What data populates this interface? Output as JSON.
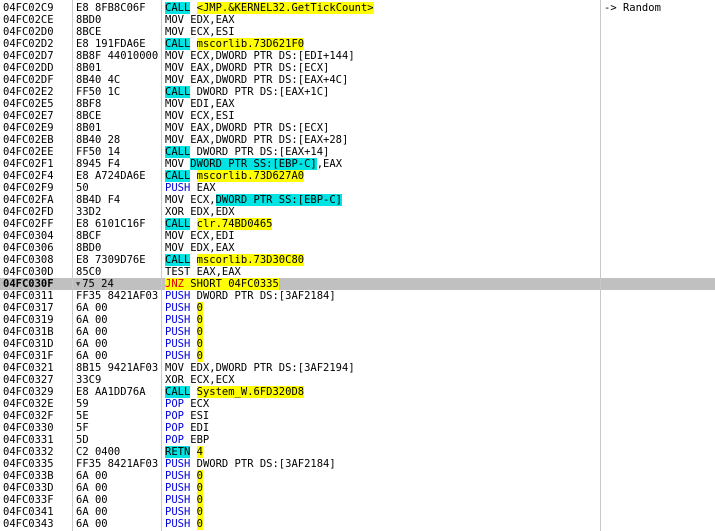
{
  "meta": {
    "view": "cpu-disassembly",
    "selected_address": "04FC030F"
  },
  "colors": {
    "background": "#ffffff",
    "text": "#000000",
    "highlight_call_bg": "#00e4e4",
    "highlight_operand_bg": "#ffff00",
    "jump_mnemonic_text": "#e00000",
    "stack_op_text": "#0000de",
    "selected_row_bg": "#c0c0c0",
    "grid_line": "#c8c8c8"
  },
  "icons": {
    "jump_down": "▼"
  },
  "rows": [
    {
      "a": "04FC02C9",
      "b": "E8 8FB8C06F",
      "d": [
        {
          "t": "CALL",
          "s": "c"
        },
        {
          "t": " ",
          "s": "p"
        },
        {
          "t": "<JMP.&KERNEL32.GetTickCount>",
          "s": "y"
        }
      ],
      "cm": "-> Random"
    },
    {
      "a": "04FC02CE",
      "b": "8BD0",
      "d": [
        {
          "t": "MOV EDX,EAX",
          "s": "p"
        }
      ]
    },
    {
      "a": "04FC02D0",
      "b": "8BCE",
      "d": [
        {
          "t": "MOV ECX,ESI",
          "s": "p"
        }
      ]
    },
    {
      "a": "04FC02D2",
      "b": "E8 191FDA6E",
      "d": [
        {
          "t": "CALL",
          "s": "c"
        },
        {
          "t": " ",
          "s": "p"
        },
        {
          "t": "mscorlib.73D621F0",
          "s": "y"
        }
      ]
    },
    {
      "a": "04FC02D7",
      "b": "8B8F 44010000",
      "d": [
        {
          "t": "MOV ECX,DWORD PTR DS:[EDI+144]",
          "s": "p"
        }
      ]
    },
    {
      "a": "04FC02DD",
      "b": "8B01",
      "d": [
        {
          "t": "MOV EAX,DWORD PTR DS:[ECX]",
          "s": "p"
        }
      ]
    },
    {
      "a": "04FC02DF",
      "b": "8B40 4C",
      "d": [
        {
          "t": "MOV EAX,DWORD PTR DS:[EAX+4C]",
          "s": "p"
        }
      ]
    },
    {
      "a": "04FC02E2",
      "b": "FF50 1C",
      "d": [
        {
          "t": "CALL",
          "s": "c"
        },
        {
          "t": " DWORD PTR DS:[EAX+1C]",
          "s": "p"
        }
      ]
    },
    {
      "a": "04FC02E5",
      "b": "8BF8",
      "d": [
        {
          "t": "MOV EDI,EAX",
          "s": "p"
        }
      ]
    },
    {
      "a": "04FC02E7",
      "b": "8BCE",
      "d": [
        {
          "t": "MOV ECX,ESI",
          "s": "p"
        }
      ]
    },
    {
      "a": "04FC02E9",
      "b": "8B01",
      "d": [
        {
          "t": "MOV EAX,DWORD PTR DS:[ECX]",
          "s": "p"
        }
      ]
    },
    {
      "a": "04FC02EB",
      "b": "8B40 28",
      "d": [
        {
          "t": "MOV EAX,DWORD PTR DS:[EAX+28]",
          "s": "p"
        }
      ]
    },
    {
      "a": "04FC02EE",
      "b": "FF50 14",
      "d": [
        {
          "t": "CALL",
          "s": "c"
        },
        {
          "t": " DWORD PTR DS:[EAX+14]",
          "s": "p"
        }
      ]
    },
    {
      "a": "04FC02F1",
      "b": "8945 F4",
      "d": [
        {
          "t": "MOV ",
          "s": "p"
        },
        {
          "t": "DWORD PTR SS:[EBP-C]",
          "s": "c"
        },
        {
          "t": ",EAX",
          "s": "p"
        }
      ]
    },
    {
      "a": "04FC02F4",
      "b": "E8 A724DA6E",
      "d": [
        {
          "t": "CALL",
          "s": "c"
        },
        {
          "t": " ",
          "s": "p"
        },
        {
          "t": "mscorlib.73D627A0",
          "s": "y"
        }
      ]
    },
    {
      "a": "04FC02F9",
      "b": "50",
      "d": [
        {
          "t": "PUSH",
          "s": "b"
        },
        {
          "t": " EAX",
          "s": "p"
        }
      ]
    },
    {
      "a": "04FC02FA",
      "b": "8B4D F4",
      "d": [
        {
          "t": "MOV ECX,",
          "s": "p"
        },
        {
          "t": "DWORD PTR SS:[EBP-C]",
          "s": "c"
        }
      ]
    },
    {
      "a": "04FC02FD",
      "b": "33D2",
      "d": [
        {
          "t": "XOR EDX,EDX",
          "s": "p"
        }
      ]
    },
    {
      "a": "04FC02FF",
      "b": "E8 6101C16F",
      "d": [
        {
          "t": "CALL",
          "s": "c"
        },
        {
          "t": " ",
          "s": "p"
        },
        {
          "t": "clr.74BD0465",
          "s": "y"
        }
      ]
    },
    {
      "a": "04FC0304",
      "b": "8BCF",
      "d": [
        {
          "t": "MOV ECX,EDI",
          "s": "p"
        }
      ]
    },
    {
      "a": "04FC0306",
      "b": "8BD0",
      "d": [
        {
          "t": "MOV EDX,EAX",
          "s": "p"
        }
      ]
    },
    {
      "a": "04FC0308",
      "b": "E8 7309D76E",
      "d": [
        {
          "t": "CALL",
          "s": "c"
        },
        {
          "t": " ",
          "s": "p"
        },
        {
          "t": "mscorlib.73D30C80",
          "s": "y"
        }
      ]
    },
    {
      "a": "04FC030D",
      "b": "85C0",
      "d": [
        {
          "t": "TEST EAX,EAX",
          "s": "p"
        }
      ]
    },
    {
      "a": "04FC030F",
      "b": "75 24",
      "sel": true,
      "mk": true,
      "d": [
        {
          "t": "JNZ",
          "s": "r"
        },
        {
          "t": " SHORT 04FC0335",
          "s": "y"
        }
      ]
    },
    {
      "a": "04FC0311",
      "b": "FF35 8421AF03",
      "d": [
        {
          "t": "PUSH",
          "s": "b"
        },
        {
          "t": " DWORD PTR DS:[3AF2184]",
          "s": "p"
        }
      ]
    },
    {
      "a": "04FC0317",
      "b": "6A 00",
      "d": [
        {
          "t": "PUSH",
          "s": "b"
        },
        {
          "t": " ",
          "s": "p"
        },
        {
          "t": "0",
          "s": "y"
        }
      ]
    },
    {
      "a": "04FC0319",
      "b": "6A 00",
      "d": [
        {
          "t": "PUSH",
          "s": "b"
        },
        {
          "t": " ",
          "s": "p"
        },
        {
          "t": "0",
          "s": "y"
        }
      ]
    },
    {
      "a": "04FC031B",
      "b": "6A 00",
      "d": [
        {
          "t": "PUSH",
          "s": "b"
        },
        {
          "t": " ",
          "s": "p"
        },
        {
          "t": "0",
          "s": "y"
        }
      ]
    },
    {
      "a": "04FC031D",
      "b": "6A 00",
      "d": [
        {
          "t": "PUSH",
          "s": "b"
        },
        {
          "t": " ",
          "s": "p"
        },
        {
          "t": "0",
          "s": "y"
        }
      ]
    },
    {
      "a": "04FC031F",
      "b": "6A 00",
      "d": [
        {
          "t": "PUSH",
          "s": "b"
        },
        {
          "t": " ",
          "s": "p"
        },
        {
          "t": "0",
          "s": "y"
        }
      ]
    },
    {
      "a": "04FC0321",
      "b": "8B15 9421AF03",
      "d": [
        {
          "t": "MOV EDX,DWORD PTR DS:[3AF2194]",
          "s": "p"
        }
      ]
    },
    {
      "a": "04FC0327",
      "b": "33C9",
      "d": [
        {
          "t": "XOR ECX,ECX",
          "s": "p"
        }
      ]
    },
    {
      "a": "04FC0329",
      "b": "E8 AA1DD76A",
      "d": [
        {
          "t": "CALL",
          "s": "c"
        },
        {
          "t": " ",
          "s": "p"
        },
        {
          "t": "System_W.6FD320D8",
          "s": "y"
        }
      ]
    },
    {
      "a": "04FC032E",
      "b": "59",
      "d": [
        {
          "t": "POP",
          "s": "b"
        },
        {
          "t": " ECX",
          "s": "p"
        }
      ]
    },
    {
      "a": "04FC032F",
      "b": "5E",
      "d": [
        {
          "t": "POP",
          "s": "b"
        },
        {
          "t": " ESI",
          "s": "p"
        }
      ]
    },
    {
      "a": "04FC0330",
      "b": "5F",
      "d": [
        {
          "t": "POP",
          "s": "b"
        },
        {
          "t": " EDI",
          "s": "p"
        }
      ]
    },
    {
      "a": "04FC0331",
      "b": "5D",
      "d": [
        {
          "t": "POP",
          "s": "b"
        },
        {
          "t": " EBP",
          "s": "p"
        }
      ]
    },
    {
      "a": "04FC0332",
      "b": "C2 0400",
      "d": [
        {
          "t": "RETN",
          "s": "c"
        },
        {
          "t": " ",
          "s": "p"
        },
        {
          "t": "4",
          "s": "y"
        }
      ]
    },
    {
      "a": "04FC0335",
      "b": "FF35 8421AF03",
      "d": [
        {
          "t": "PUSH",
          "s": "b"
        },
        {
          "t": " DWORD PTR DS:[3AF2184]",
          "s": "p"
        }
      ]
    },
    {
      "a": "04FC033B",
      "b": "6A 00",
      "d": [
        {
          "t": "PUSH",
          "s": "b"
        },
        {
          "t": " ",
          "s": "p"
        },
        {
          "t": "0",
          "s": "y"
        }
      ]
    },
    {
      "a": "04FC033D",
      "b": "6A 00",
      "d": [
        {
          "t": "PUSH",
          "s": "b"
        },
        {
          "t": " ",
          "s": "p"
        },
        {
          "t": "0",
          "s": "y"
        }
      ]
    },
    {
      "a": "04FC033F",
      "b": "6A 00",
      "d": [
        {
          "t": "PUSH",
          "s": "b"
        },
        {
          "t": " ",
          "s": "p"
        },
        {
          "t": "0",
          "s": "y"
        }
      ]
    },
    {
      "a": "04FC0341",
      "b": "6A 00",
      "d": [
        {
          "t": "PUSH",
          "s": "b"
        },
        {
          "t": " ",
          "s": "p"
        },
        {
          "t": "0",
          "s": "y"
        }
      ]
    },
    {
      "a": "04FC0343",
      "b": "6A 00",
      "d": [
        {
          "t": "PUSH",
          "s": "b"
        },
        {
          "t": " ",
          "s": "p"
        },
        {
          "t": "0",
          "s": "y"
        }
      ]
    }
  ]
}
